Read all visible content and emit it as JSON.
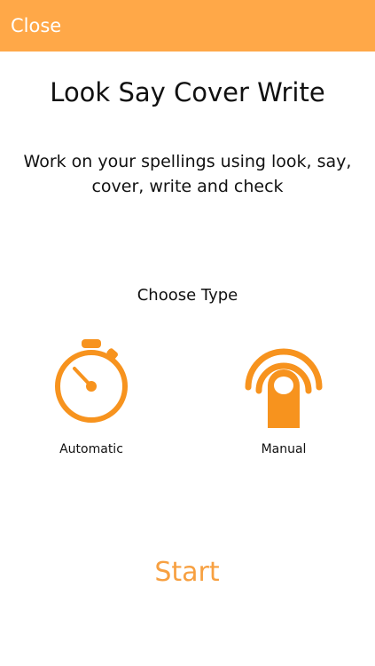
{
  "header": {
    "close_label": "Close",
    "bar_color": "#FFA848"
  },
  "main": {
    "title": "Look Say Cover Write",
    "description": "Work on your spellings using look, say, cover, write and check",
    "choose_type_label": "Choose Type",
    "options": [
      {
        "label": "Automatic",
        "icon": "stopwatch-icon"
      },
      {
        "label": "Manual",
        "icon": "finger-touch-icon"
      }
    ],
    "start_label": "Start",
    "accent_color": "#F7931E"
  }
}
